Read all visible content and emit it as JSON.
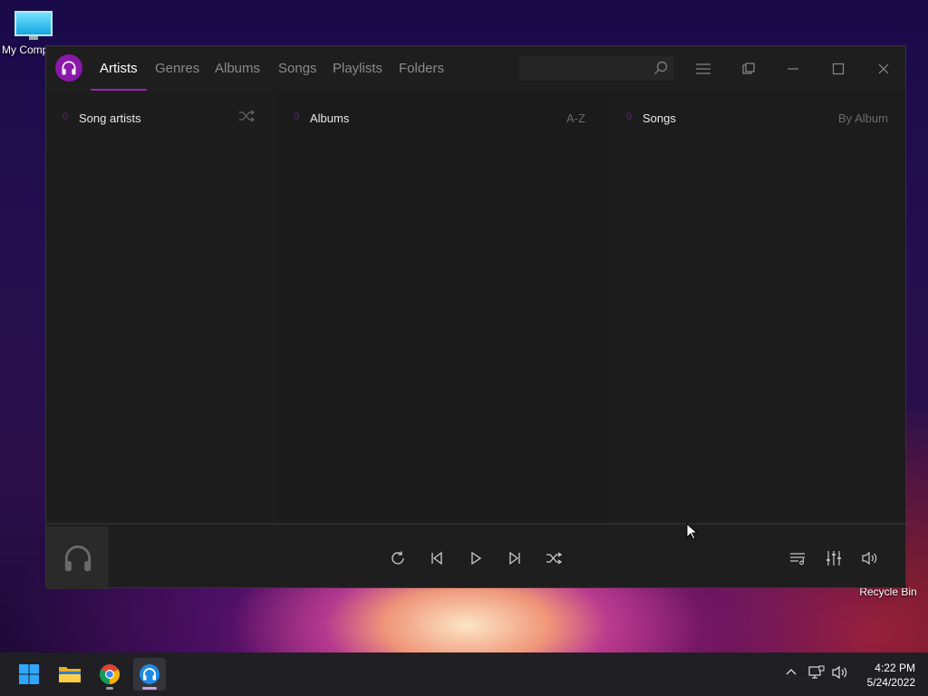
{
  "desktop": {
    "icons": [
      {
        "label": "My Comp"
      },
      {
        "label": "Recycle Bin"
      }
    ]
  },
  "window": {
    "tabs": [
      {
        "label": "Artists",
        "active": true
      },
      {
        "label": "Genres"
      },
      {
        "label": "Albums"
      },
      {
        "label": "Songs"
      },
      {
        "label": "Playlists"
      },
      {
        "label": "Folders"
      }
    ],
    "search": {
      "value": "",
      "placeholder": ""
    },
    "accent": "#a020c0"
  },
  "columns": {
    "artists": {
      "count": "0",
      "title": "Song artists"
    },
    "albums": {
      "count": "0",
      "title": "Albums",
      "sort": "A-Z"
    },
    "songs": {
      "count": "0",
      "title": "Songs",
      "sort": "By Album"
    }
  },
  "taskbar": {
    "time": "4:22 PM",
    "date": "5/24/2022"
  }
}
